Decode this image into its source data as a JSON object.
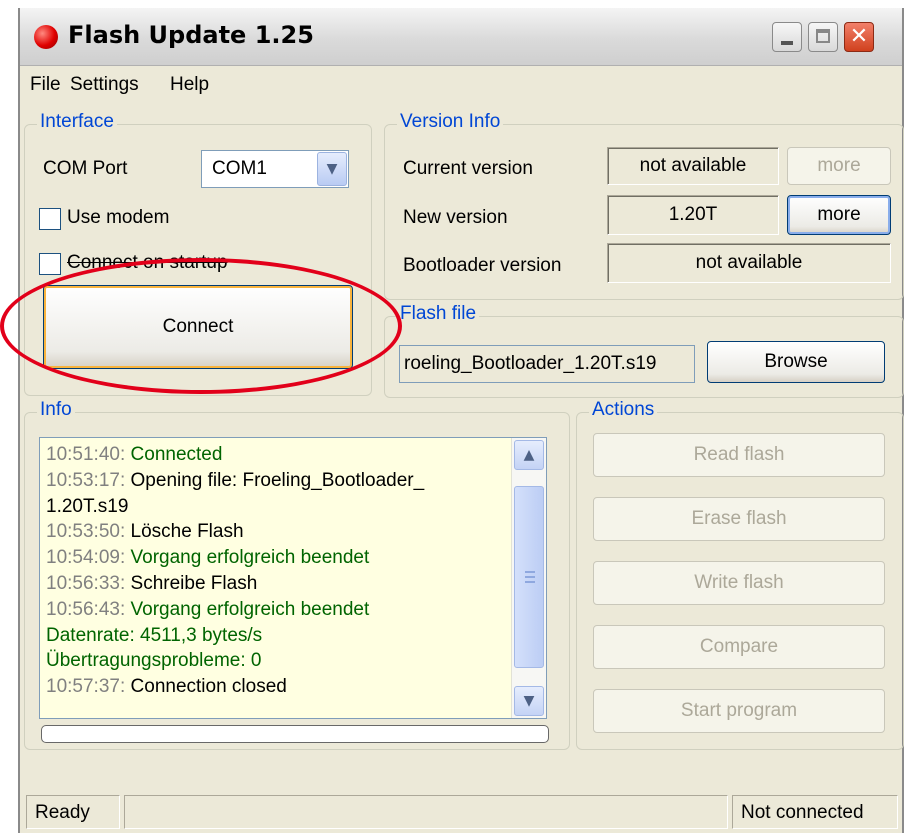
{
  "window": {
    "title": "Flash Update 1.25",
    "controls": {
      "minimize_icon": "minimize-icon",
      "maximize_icon": "maximize-icon",
      "close_glyph": "✕"
    }
  },
  "menu": [
    "File",
    "Settings",
    "Help"
  ],
  "interface": {
    "label": "Interface",
    "com_port_label": "COM Port",
    "com_port_value": "COM1",
    "use_modem_label": "Use modem",
    "connect_on_startup_label": "Connect on startup",
    "connect_label": "Connect"
  },
  "version_info": {
    "label": "Version Info",
    "current_label": "Current version",
    "current_value": "not available",
    "more_label": "more",
    "new_label": "New version",
    "new_value": "1.20T",
    "bootloader_label": "Bootloader version",
    "bootloader_value": "not available"
  },
  "flash_file": {
    "label": "Flash file",
    "value": "roeling_Bootloader_1.20T.s19",
    "browse_label": "Browse"
  },
  "info": {
    "label": "Info",
    "log": [
      {
        "time": "10:51:40:",
        "text": " Connected",
        "tone": "green"
      },
      {
        "time": "10:53:17:",
        "text": " Opening file: Froeling_Bootloader_",
        "tone": "black"
      },
      {
        "time": "",
        "text": "1.20T.s19",
        "tone": "black"
      },
      {
        "time": "10:53:50:",
        "text": " Lösche Flash",
        "tone": "black"
      },
      {
        "time": "10:54:09:",
        "text": " Vorgang erfolgreich beendet",
        "tone": "green"
      },
      {
        "time": "10:56:33:",
        "text": " Schreibe Flash",
        "tone": "black"
      },
      {
        "time": "10:56:43:",
        "text": " Vorgang erfolgreich beendet",
        "tone": "green"
      },
      {
        "time": "",
        "text": "Datenrate: 4511,3 bytes/s",
        "tone": "green"
      },
      {
        "time": "",
        "text": "Übertragungsprobleme: 0",
        "tone": "green"
      },
      {
        "time": "10:57:37:",
        "text": " Connection closed",
        "tone": "black"
      }
    ],
    "scroll_up_icon": "chevron-up-icon",
    "scroll_down_icon": "chevron-down-icon",
    "progress": 0
  },
  "actions": {
    "label": "Actions",
    "read": "Read flash",
    "erase": "Erase flash",
    "write": "Write flash",
    "compare": "Compare",
    "start": "Start program"
  },
  "status": {
    "left": "Ready",
    "right": "Not connected"
  },
  "colors": {
    "group_label": "#0046d5",
    "log_background": "#ffffe1",
    "log_green": "#006400",
    "annotation": "#e2001a"
  }
}
